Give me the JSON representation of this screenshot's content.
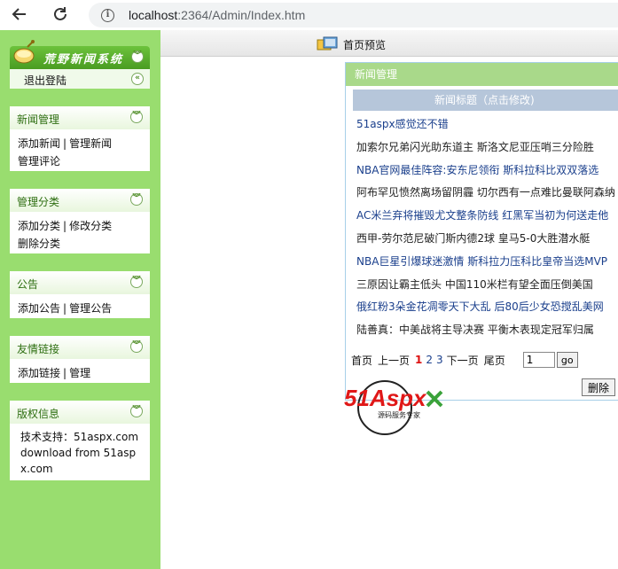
{
  "browser": {
    "url_host": "localhost",
    "url_rest": ":2364/Admin/Index.htm"
  },
  "sidebar": {
    "logo_text": "荒野新闻系统",
    "logout": "退出登陆",
    "sections": [
      {
        "title": "新闻管理",
        "links": [
          "添加新闻",
          "管理新闻",
          "管理评论"
        ]
      },
      {
        "title": "管理分类",
        "links": [
          "添加分类",
          "修改分类",
          "删除分类"
        ]
      },
      {
        "title": "公告",
        "links": [
          "添加公告",
          "管理公告"
        ]
      },
      {
        "title": "友情链接",
        "links": [
          "添加链接",
          "管理"
        ]
      },
      {
        "title": "版权信息",
        "lines": [
          "技术支持：51aspx.com",
          "download from 51asp",
          "x.com"
        ]
      }
    ]
  },
  "topbar": {
    "home_label": "首页预览"
  },
  "news": {
    "panel_title": "新闻管理",
    "column_header": "新闻标题（点击修改)",
    "rows": [
      "51aspx感觉还不错",
      "加索尔兄弟闪光助东道主 斯洛文尼亚压哨三分险胜",
      "NBA官网最佳阵容:安东尼领衔 斯科拉科比双双落选",
      "阿布罕见愤然离场留阴霾 切尔西有一点难比曼联阿森纳",
      "AC米兰弃将摧毁尤文整条防线 红黑军当初为何送走他",
      "西甲-劳尔范尼破门斯内德2球 皇马5-0大胜潜水艇",
      "NBA巨星引爆球迷激情 斯科拉力压科比皇帝当选MVP",
      "三原因让霸主低头 中国110米栏有望全面压倒美国",
      "俄红粉3朵金花凋零天下大乱 后80后少女恐搅乱美网",
      "陆善真：中美战将主导决赛 平衡木表现定冠军归属"
    ],
    "pager": {
      "first": "首页",
      "prev": "上一页",
      "pages": [
        "1",
        "2",
        "3"
      ],
      "next": "下一页",
      "last": "尾页",
      "input_value": "1",
      "go": "go"
    },
    "delete_label": "删除"
  },
  "watermark": {
    "brand": "51Aspx",
    "tagline": "源码服务专家"
  }
}
